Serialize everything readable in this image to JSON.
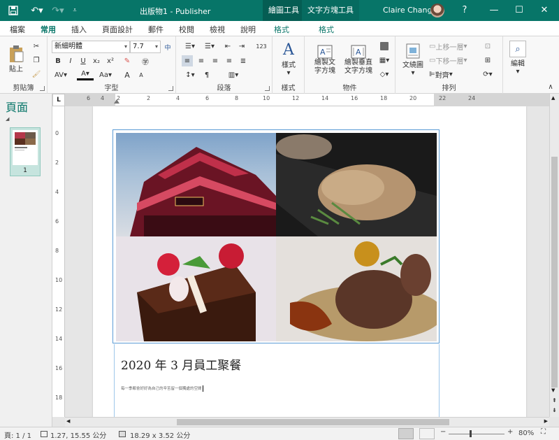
{
  "app": {
    "title": "出版物1 - Publisher",
    "user": "Claire Chang",
    "help": "?"
  },
  "contextual_tabs": [
    "繪圖工具",
    "文字方塊工具"
  ],
  "tabs": [
    "檔案",
    "常用",
    "插入",
    "頁面設計",
    "郵件",
    "校閱",
    "檢視",
    "說明",
    "格式",
    "格式"
  ],
  "ribbon": {
    "clipboard": {
      "label": "剪貼簿",
      "paste": "貼上"
    },
    "font": {
      "label": "字型",
      "name": "新細明體",
      "size": "7.7",
      "bold": "B",
      "italic": "I",
      "underline": "U",
      "subscript": "x₂",
      "superscript": "x²",
      "grow": "A",
      "shrink": "A",
      "case": "Aa"
    },
    "paragraph": {
      "label": "段落"
    },
    "styles": {
      "label": "樣式",
      "button": "樣式"
    },
    "objects": {
      "label": "物件",
      "draw_textbox": "繪製文字方塊",
      "draw_vertical_textbox": "繪製垂直文字方塊"
    },
    "arrange": {
      "label": "排列",
      "wrap": "文繞圖",
      "bring_forward": "上移一層",
      "send_backward": "下移一層",
      "align": "對齊"
    },
    "editing": {
      "label": "編輯",
      "button": "編輯"
    }
  },
  "pages_pane": {
    "title": "頁面",
    "page_number": "1"
  },
  "ruler_corner": "L",
  "ruler_top_ticks": [
    "6",
    "4",
    "2",
    "",
    "2",
    "4",
    "6",
    "8",
    "10",
    "12",
    "14",
    "16",
    "18",
    "20",
    "22",
    "24"
  ],
  "ruler_left_ticks": [
    "0",
    "2",
    "4",
    "6",
    "8",
    "10",
    "12",
    "14",
    "16",
    "18"
  ],
  "document": {
    "heading": "2020 年 3 月員工聚餐",
    "body": "每一季都會好好為自己的辛苦留一個獨處的空間"
  },
  "status": {
    "page": "頁: 1 / 1",
    "position": "1.27, 15.55 公分",
    "size": "18.29 x  3.52 公分",
    "zoom": "80%"
  },
  "colors": {
    "accent": "#077568"
  }
}
